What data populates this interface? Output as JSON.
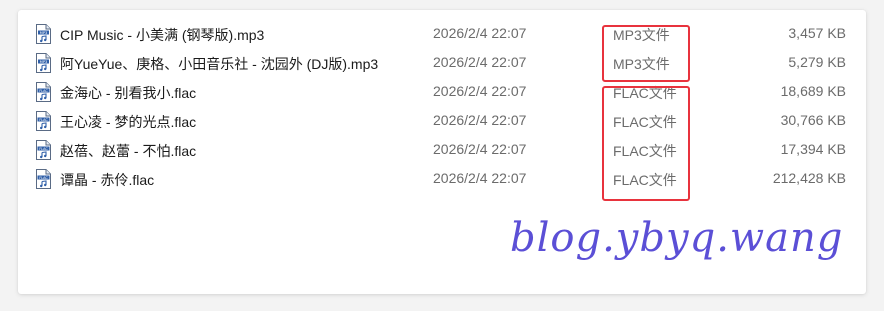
{
  "files": [
    {
      "name": "CIP Music - 小美满 (钢琴版).mp3",
      "date": "2026/2/4 22:07",
      "type": "MP3文件",
      "size": "3,457 KB",
      "icon": "mp3-file-icon"
    },
    {
      "name": "阿YueYue、庚格、小田音乐社 - 沈园外 (DJ版).mp3",
      "date": "2026/2/4 22:07",
      "type": "MP3文件",
      "size": "5,279 KB",
      "icon": "mp3-file-icon"
    },
    {
      "name": "金海心 - 别看我小.flac",
      "date": "2026/2/4 22:07",
      "type": "FLAC文件",
      "size": "18,689 KB",
      "icon": "flac-file-icon"
    },
    {
      "name": "王心凌 - 梦的光点.flac",
      "date": "2026/2/4 22:07",
      "type": "FLAC文件",
      "size": "30,766 KB",
      "icon": "flac-file-icon"
    },
    {
      "name": "赵蓓、赵蕾 - 不怕.flac",
      "date": "2026/2/4 22:07",
      "type": "FLAC文件",
      "size": "17,394 KB",
      "icon": "flac-file-icon"
    },
    {
      "name": "谭晶 - 赤伶.flac",
      "date": "2026/2/4 22:07",
      "type": "FLAC文件",
      "size": "212,428 KB",
      "icon": "flac-file-icon"
    }
  ],
  "watermark": "blog.ybyq.wang",
  "colors": {
    "highlight": "#e8333d",
    "watermark": "#5b4fd6",
    "icon_accent": "#2f5fa8"
  }
}
